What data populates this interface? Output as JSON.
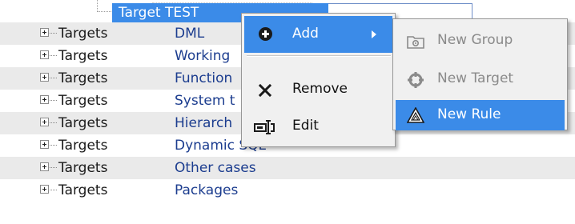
{
  "selected": {
    "type": "Target",
    "name": "TEST"
  },
  "rows": [
    {
      "type": "Targets",
      "name": "DML"
    },
    {
      "type": "Targets",
      "name": "Working"
    },
    {
      "type": "Targets",
      "name": "Function"
    },
    {
      "type": "Targets",
      "name": "System t"
    },
    {
      "type": "Targets",
      "name": "Hierarch"
    },
    {
      "type": "Targets",
      "name": "Dynamic SQL"
    },
    {
      "type": "Targets",
      "name": "Other cases"
    },
    {
      "type": "Targets",
      "name": "Packages"
    }
  ],
  "context_menu": {
    "add": {
      "label": "Add",
      "icon": "plus-circle-icon"
    },
    "remove": {
      "label": "Remove",
      "icon": "x-icon"
    },
    "edit": {
      "label": "Edit",
      "icon": "edit-field-icon"
    }
  },
  "submenu": {
    "new_group": {
      "label": "New Group",
      "icon": "folder-group-icon",
      "enabled": false
    },
    "new_target": {
      "label": "New Target",
      "icon": "target-icon",
      "enabled": false
    },
    "new_rule": {
      "label": "New Rule",
      "icon": "warning-rule-icon",
      "enabled": true
    }
  },
  "colors": {
    "selection": "#3b8be8",
    "menu_bg": "#f0f0f0",
    "alt_row": "#eaeaea",
    "link_text": "#1c3d8f",
    "disabled_text": "#8a8a8a"
  }
}
